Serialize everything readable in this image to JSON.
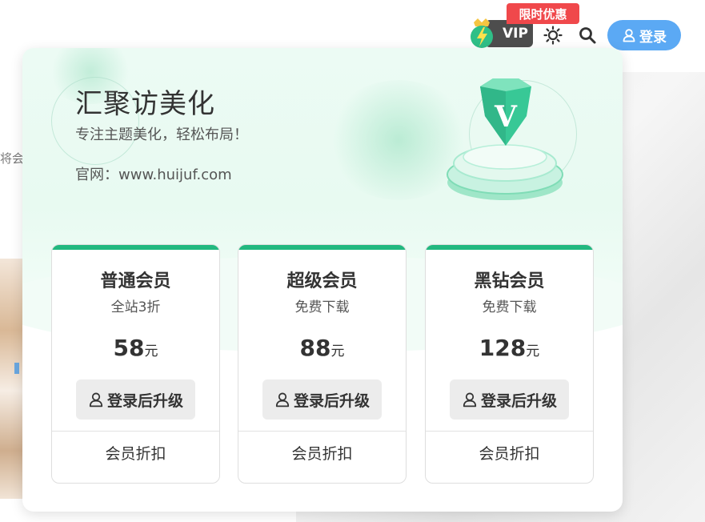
{
  "header": {
    "promo_label": "限时优惠",
    "vip_label": "VIP",
    "login_label": "登录"
  },
  "background": {
    "side_text": "将会"
  },
  "popup": {
    "title": "汇聚访美化",
    "subtitle": "专注主题美化，轻松布局！",
    "website": "官网：www.huijuf.com",
    "badge_letter": "V",
    "plans": [
      {
        "name": "普通会员",
        "desc": "全站3折",
        "price": "58",
        "unit": "元",
        "button_label": "登录后升级",
        "footer_label": "会员折扣"
      },
      {
        "name": "超级会员",
        "desc": "免费下载",
        "price": "88",
        "unit": "元",
        "button_label": "登录后升级",
        "footer_label": "会员折扣"
      },
      {
        "name": "黑钻会员",
        "desc": "免费下载",
        "price": "128",
        "unit": "元",
        "button_label": "登录后升级",
        "footer_label": "会员折扣"
      }
    ]
  },
  "colors": {
    "accent_green": "#22b87f",
    "login_blue": "#5ba9f4",
    "promo_red": "#f0484b",
    "vip_dark": "#4d4d4d"
  },
  "icons": [
    "crown-lightning-icon",
    "sun-icon",
    "search-icon",
    "user-icon"
  ]
}
